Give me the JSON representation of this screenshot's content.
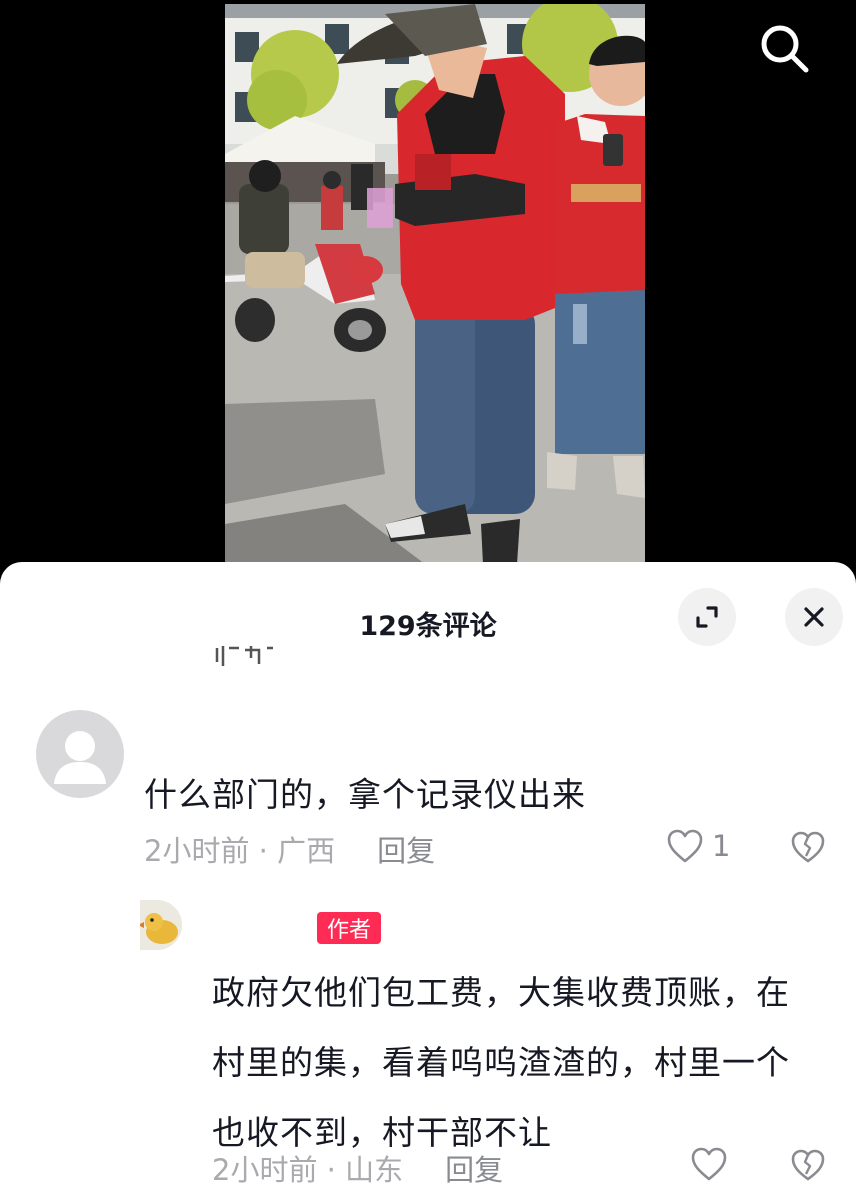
{
  "video": {
    "search_icon": "search-icon"
  },
  "comments_panel": {
    "title": "129条评论",
    "expand_icon": "expand-icon",
    "close_icon": "close-icon",
    "comments": [
      {
        "text": "什么部门的，拿个记录仪出来",
        "time_location": "2小时前 · 广西",
        "reply_label": "回复",
        "like_count": "1"
      },
      {
        "badge": "作者",
        "lines": [
          "政府欠他们包工费，大集收费顶账，在",
          "村里的集，看着呜呜渣渣的，村里一个",
          "也收不到，村干部不让"
        ],
        "time_location": "2小时前 · 山东",
        "reply_label": "回复"
      }
    ]
  },
  "colors": {
    "accent": "#fe2c55",
    "text": "#161823",
    "meta": "#a9a9ae",
    "vest_red": "#d8272d"
  }
}
